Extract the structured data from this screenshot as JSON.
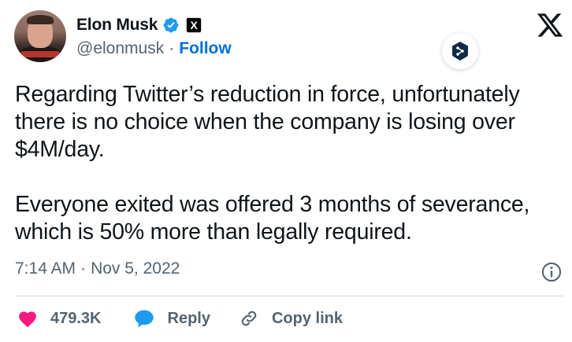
{
  "author": {
    "name": "Elon Musk",
    "handle": "@elonmusk",
    "separator": "·",
    "follow_label": "Follow"
  },
  "tweet": {
    "paragraphs": [
      "Regarding Twitter’s reduction in force, unfortunately there is no choice when the company is losing over $4M/day.",
      "Everyone exited was offered 3 months of severance, which is 50% more than legally required."
    ],
    "time": "7:14 AM",
    "date": "Nov 5, 2022",
    "separator": "·"
  },
  "actions": {
    "like_count": "479.3K",
    "reply_label": "Reply",
    "copy_label": "Copy link"
  },
  "badge": {
    "x_letter": "X"
  },
  "colors": {
    "link_blue": "#006fd6",
    "verified_blue": "#1d9bf0",
    "like_pink": "#f91880",
    "muted": "#536471",
    "text": "#0f1419"
  },
  "icons": {
    "verified": "verified-badge-icon",
    "x_logo": "x-logo-icon",
    "deepl": "deepl-translate-icon",
    "info": "info-icon",
    "like": "heart-icon",
    "reply": "speech-bubble-icon",
    "copy": "link-icon"
  }
}
